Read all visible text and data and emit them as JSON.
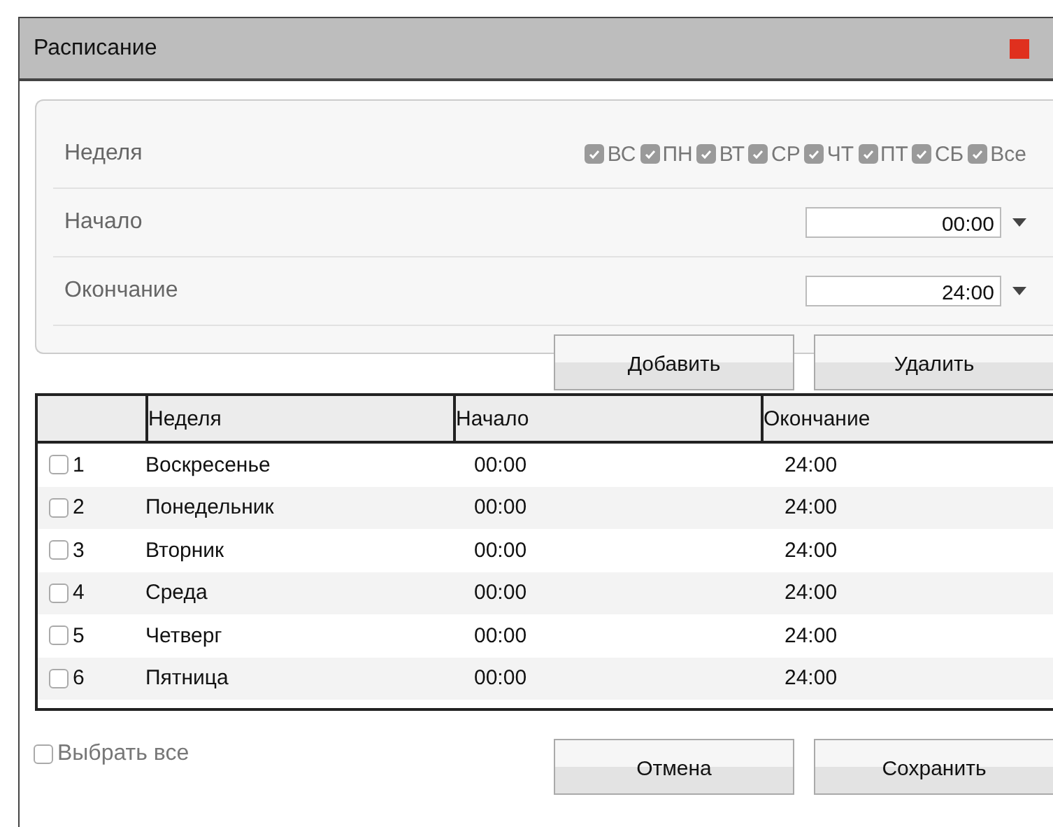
{
  "window": {
    "title": "Расписание"
  },
  "form": {
    "week_label": "Неделя",
    "days": [
      {
        "label": "ВС",
        "checked": true
      },
      {
        "label": "ПН",
        "checked": true
      },
      {
        "label": "ВТ",
        "checked": true
      },
      {
        "label": "СР",
        "checked": true
      },
      {
        "label": "ЧТ",
        "checked": true
      },
      {
        "label": "ПТ",
        "checked": true
      },
      {
        "label": "СБ",
        "checked": true
      },
      {
        "label": "Все",
        "checked": true
      }
    ],
    "start_label": "Начало",
    "start_value": "00:00",
    "end_label": "Окончание",
    "end_value": "24:00"
  },
  "actions": [
    "Добавить",
    "Удалить"
  ],
  "table": {
    "columns": [
      "Неделя",
      "Начало",
      "Окончание"
    ],
    "rows": [
      {
        "index": "1",
        "day": "Воскресенье",
        "start": "00:00",
        "end": "24:00",
        "checked": false
      },
      {
        "index": "2",
        "day": "Понедельник",
        "start": "00:00",
        "end": "24:00",
        "checked": false
      },
      {
        "index": "3",
        "day": "Вторник",
        "start": "00:00",
        "end": "24:00",
        "checked": false
      },
      {
        "index": "4",
        "day": "Среда",
        "start": "00:00",
        "end": "24:00",
        "checked": false
      },
      {
        "index": "5",
        "day": "Четверг",
        "start": "00:00",
        "end": "24:00",
        "checked": false
      },
      {
        "index": "6",
        "day": "Пятница",
        "start": "00:00",
        "end": "24:00",
        "checked": false
      }
    ]
  },
  "select_all": {
    "label": "Выбрать все",
    "checked": false
  },
  "buttons": [
    "Отмена",
    "Сохранить"
  ]
}
